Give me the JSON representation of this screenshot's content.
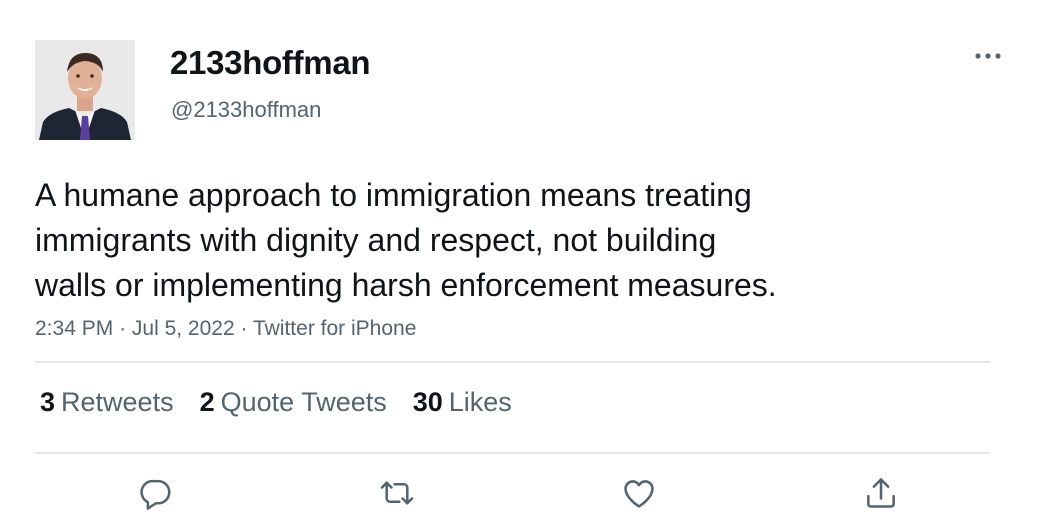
{
  "author": {
    "display_name": "2133hoffman",
    "handle": "@2133hoffman"
  },
  "tweet": {
    "text_lines": [
      "A humane approach to immigration means treating",
      "immigrants with dignity and respect, not building",
      "walls or implementing harsh enforcement measures."
    ],
    "time": "2:34 PM",
    "separator": "·",
    "date": "Jul 5, 2022",
    "source": "Twitter for iPhone"
  },
  "stats": {
    "retweets": {
      "count": "3",
      "label": "Retweets"
    },
    "quotes": {
      "count": "2",
      "label": "Quote Tweets"
    },
    "likes": {
      "count": "30",
      "label": "Likes"
    }
  },
  "icons": {
    "more": "more-horizontal-icon",
    "reply": "reply-icon",
    "retweet": "retweet-icon",
    "like": "heart-icon",
    "share": "share-icon"
  },
  "colors": {
    "text_primary": "#0f1419",
    "text_secondary": "#536471",
    "divider": "#e3e6e8"
  }
}
